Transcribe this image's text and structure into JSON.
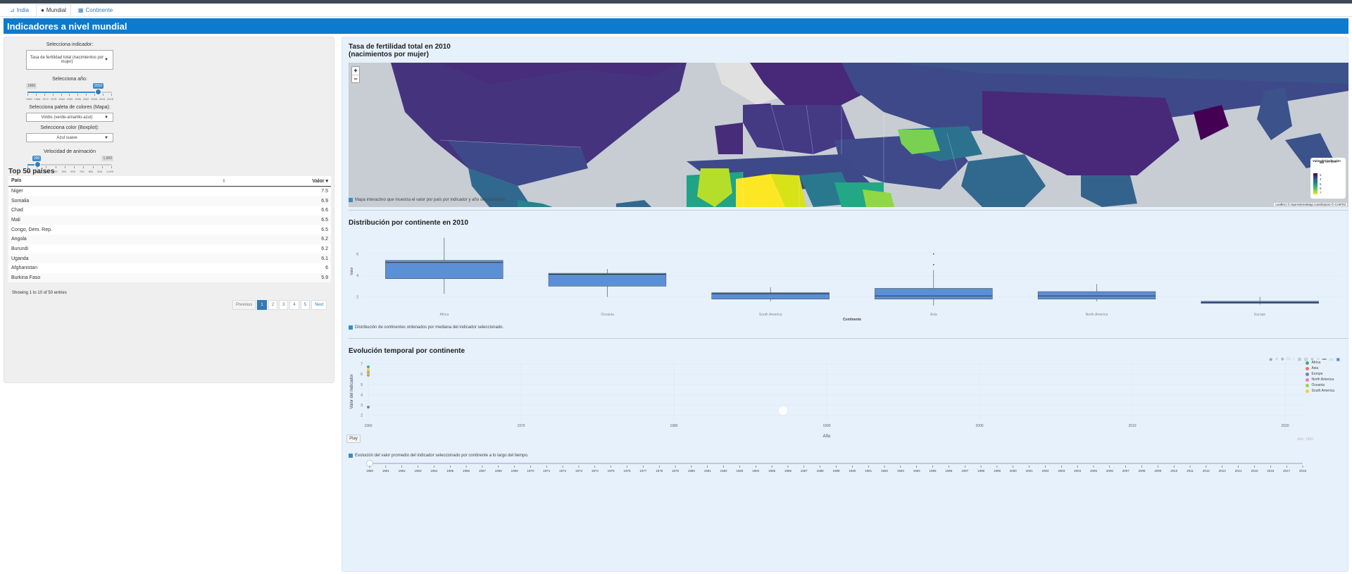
{
  "nav": {
    "tabs": [
      {
        "label": "India",
        "icon": "chart-icon"
      },
      {
        "label": "Mundial",
        "icon": "globe-icon"
      },
      {
        "label": "Continente",
        "icon": "grid-icon"
      }
    ]
  },
  "page_title": "Indicadores a nivel mundial",
  "sidebar": {
    "indicator_label": "Selecciona indicador:",
    "indicator_value": "Tasa de fertilidad total (nacimientos por mujer)",
    "year_label": "Selecciona año:",
    "year_min": "1960",
    "year_value": "2010",
    "year_ticks": [
      "1960",
      "1966",
      "1972",
      "1978",
      "1984",
      "1990",
      "1996",
      "2002",
      "2008",
      "2014",
      "2018"
    ],
    "palette_label": "Selecciona paleta de colores (Mapa):",
    "palette_value": "Viridis (verde-amarillo-azul)",
    "color_label": "Selecciona color (Boxplot):",
    "color_value": "Azul suave",
    "speed_label": "Velocidad de animación",
    "speed_value": "200",
    "speed_max": "1,000",
    "speed_ticks": [
      "100",
      "200",
      "300",
      "400",
      "500",
      "600",
      "700",
      "800",
      "900",
      "1,000"
    ],
    "top50_title": "Top 50 países",
    "table": {
      "columns": [
        "País",
        "Valor"
      ],
      "rows": [
        [
          "Niger",
          "7.5"
        ],
        [
          "Somalia",
          "6.9"
        ],
        [
          "Chad",
          "6.6"
        ],
        [
          "Mali",
          "6.5"
        ],
        [
          "Congo, Dem. Rep.",
          "6.5"
        ],
        [
          "Angola",
          "6.2"
        ],
        [
          "Burundi",
          "6.2"
        ],
        [
          "Uganda",
          "6.1"
        ],
        [
          "Afghanistan",
          "6"
        ],
        [
          "Burkina Faso",
          "5.9"
        ]
      ]
    },
    "table_info": "Showing 1 to 10 of 50 entries",
    "pager": [
      "Previous",
      "1",
      "2",
      "3",
      "4",
      "5",
      "Next"
    ]
  },
  "map": {
    "title_line1": "Tasa de fertilidad total en 2010",
    "title_line2": "(nacimientos por mujer)",
    "zoom_in": "+",
    "zoom_out": "−",
    "legend_title": "Valor del indicador",
    "legend_nodata": "Sin dato",
    "legend_ticks": [
      "3",
      "4",
      "5",
      "6",
      "7"
    ],
    "attribution": "Leaflet | © OpenStreetMap contributors © CARTO",
    "note": "Mapa interactivo que muestra el valor por país por indicador y año seleccionado.",
    "colors": {
      "low": "#440154",
      "mid": "#21918c",
      "high": "#fde725",
      "nodata": "#c7cdd3"
    }
  },
  "boxplot": {
    "title": "Distribución por continente en 2010",
    "note": "Distribución de continentes ordenados por mediana del indicador seleccionado.",
    "color": "#5b8fd6",
    "chart_data": {
      "type": "box",
      "xlabel": "Continente",
      "ylabel": "Valor",
      "ylim": [
        0.8,
        8
      ],
      "yticks": [
        2,
        4,
        6
      ],
      "categories": [
        "Africa",
        "Oceania",
        "South America",
        "Asia",
        "North America",
        "Europe"
      ],
      "boxes": [
        {
          "min": 2.3,
          "q1": 3.7,
          "median": 5.2,
          "q3": 5.4,
          "max": 7.5,
          "outliers": []
        },
        {
          "min": 2.0,
          "q1": 3.0,
          "median": 4.1,
          "q3": 4.2,
          "max": 4.6,
          "outliers": []
        },
        {
          "min": 1.6,
          "q1": 1.8,
          "median": 2.3,
          "q3": 2.4,
          "max": 2.9,
          "outliers": []
        },
        {
          "min": 1.2,
          "q1": 1.8,
          "median": 2.1,
          "q3": 2.8,
          "max": 4.5,
          "outliers": [
            5.0,
            6.0
          ]
        },
        {
          "min": 1.6,
          "q1": 1.8,
          "median": 2.1,
          "q3": 2.5,
          "max": 3.2,
          "outliers": []
        },
        {
          "min": 1.3,
          "q1": 1.4,
          "median": 1.5,
          "q3": 1.6,
          "max": 2.0,
          "outliers": []
        }
      ]
    }
  },
  "evolution": {
    "title": "Evolución temporal por continente",
    "note": "Evolución del valor promedio del indicador seleccionado por continente a lo largo del tiempo.",
    "play_label": "Play",
    "current_year_label": "Año: 1960",
    "chart_data": {
      "type": "scatter",
      "xlabel": "Año",
      "ylabel": "Valor del indicador",
      "xlim": [
        1960,
        2020
      ],
      "ylim": [
        1.5,
        7.1
      ],
      "xticks": [
        1960,
        1970,
        1980,
        1990,
        2000,
        2010,
        2020
      ],
      "yticks": [
        2,
        3,
        4,
        5,
        6,
        7
      ],
      "series": [
        {
          "name": "Africa",
          "color": "#3cb371",
          "points": [
            [
              1960,
              6.7
            ]
          ]
        },
        {
          "name": "Asia",
          "color": "#e9746a",
          "points": [
            [
              1960,
              5.9
            ]
          ]
        },
        {
          "name": "Europe",
          "color": "#7b7fbf",
          "points": [
            [
              1960,
              2.8
            ]
          ]
        },
        {
          "name": "North America",
          "color": "#e37cc5",
          "points": [
            [
              1960,
              6.2
            ]
          ]
        },
        {
          "name": "Oceania",
          "color": "#9cd14a",
          "points": [
            [
              1960,
              6.0
            ]
          ]
        },
        {
          "name": "South America",
          "color": "#f5cd30",
          "points": [
            [
              1960,
              6.4
            ]
          ]
        }
      ]
    },
    "slider_years": [
      "1960",
      "1961",
      "1962",
      "1963",
      "1964",
      "1965",
      "1966",
      "1967",
      "1968",
      "1969",
      "1970",
      "1971",
      "1972",
      "1973",
      "1974",
      "1975",
      "1976",
      "1977",
      "1978",
      "1979",
      "1980",
      "1981",
      "1982",
      "1983",
      "1984",
      "1985",
      "1986",
      "1987",
      "1988",
      "1989",
      "1990",
      "1991",
      "1992",
      "1993",
      "1994",
      "1995",
      "1996",
      "1997",
      "1998",
      "1999",
      "2000",
      "2001",
      "2002",
      "2003",
      "2004",
      "2005",
      "2006",
      "2007",
      "2008",
      "2009",
      "2010",
      "2011",
      "2012",
      "2013",
      "2014",
      "2015",
      "2016",
      "2017",
      "2018"
    ]
  }
}
